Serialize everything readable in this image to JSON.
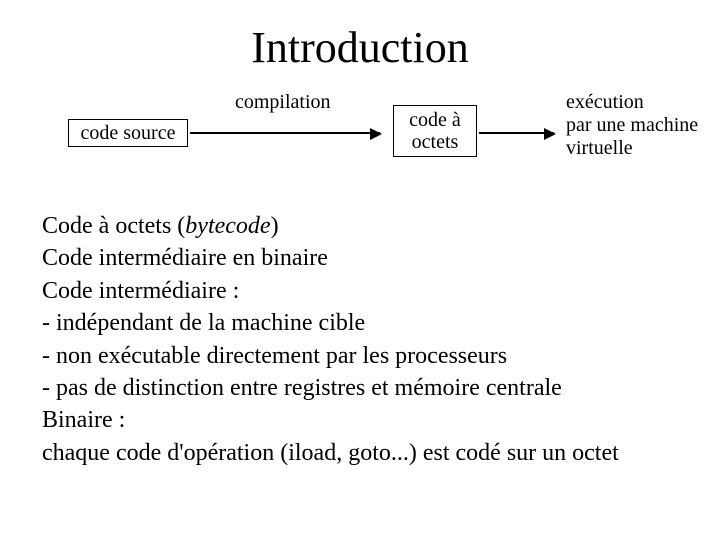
{
  "title": "Introduction",
  "diagram": {
    "source_box": "code source",
    "compilation_label": "compilation",
    "bytecode_box_line1": "code à",
    "bytecode_box_line2": "octets",
    "execution_label_line1": "exécution",
    "execution_label_line2": "par une machine",
    "execution_label_line3": "virtuelle"
  },
  "body": {
    "l1_prefix": "Code à octets (",
    "l1_italic": "bytecode",
    "l1_suffix": ")",
    "l2": "Code intermédiaire en binaire",
    "l3": "Code intermédiaire :",
    "l4": "- indépendant de la machine cible",
    "l5": "- non exécutable directement par les processeurs",
    "l6": "- pas de distinction entre registres et mémoire centrale",
    "l7": "Binaire :",
    "l8": "chaque code d'opération (iload, goto...) est codé sur un octet"
  }
}
